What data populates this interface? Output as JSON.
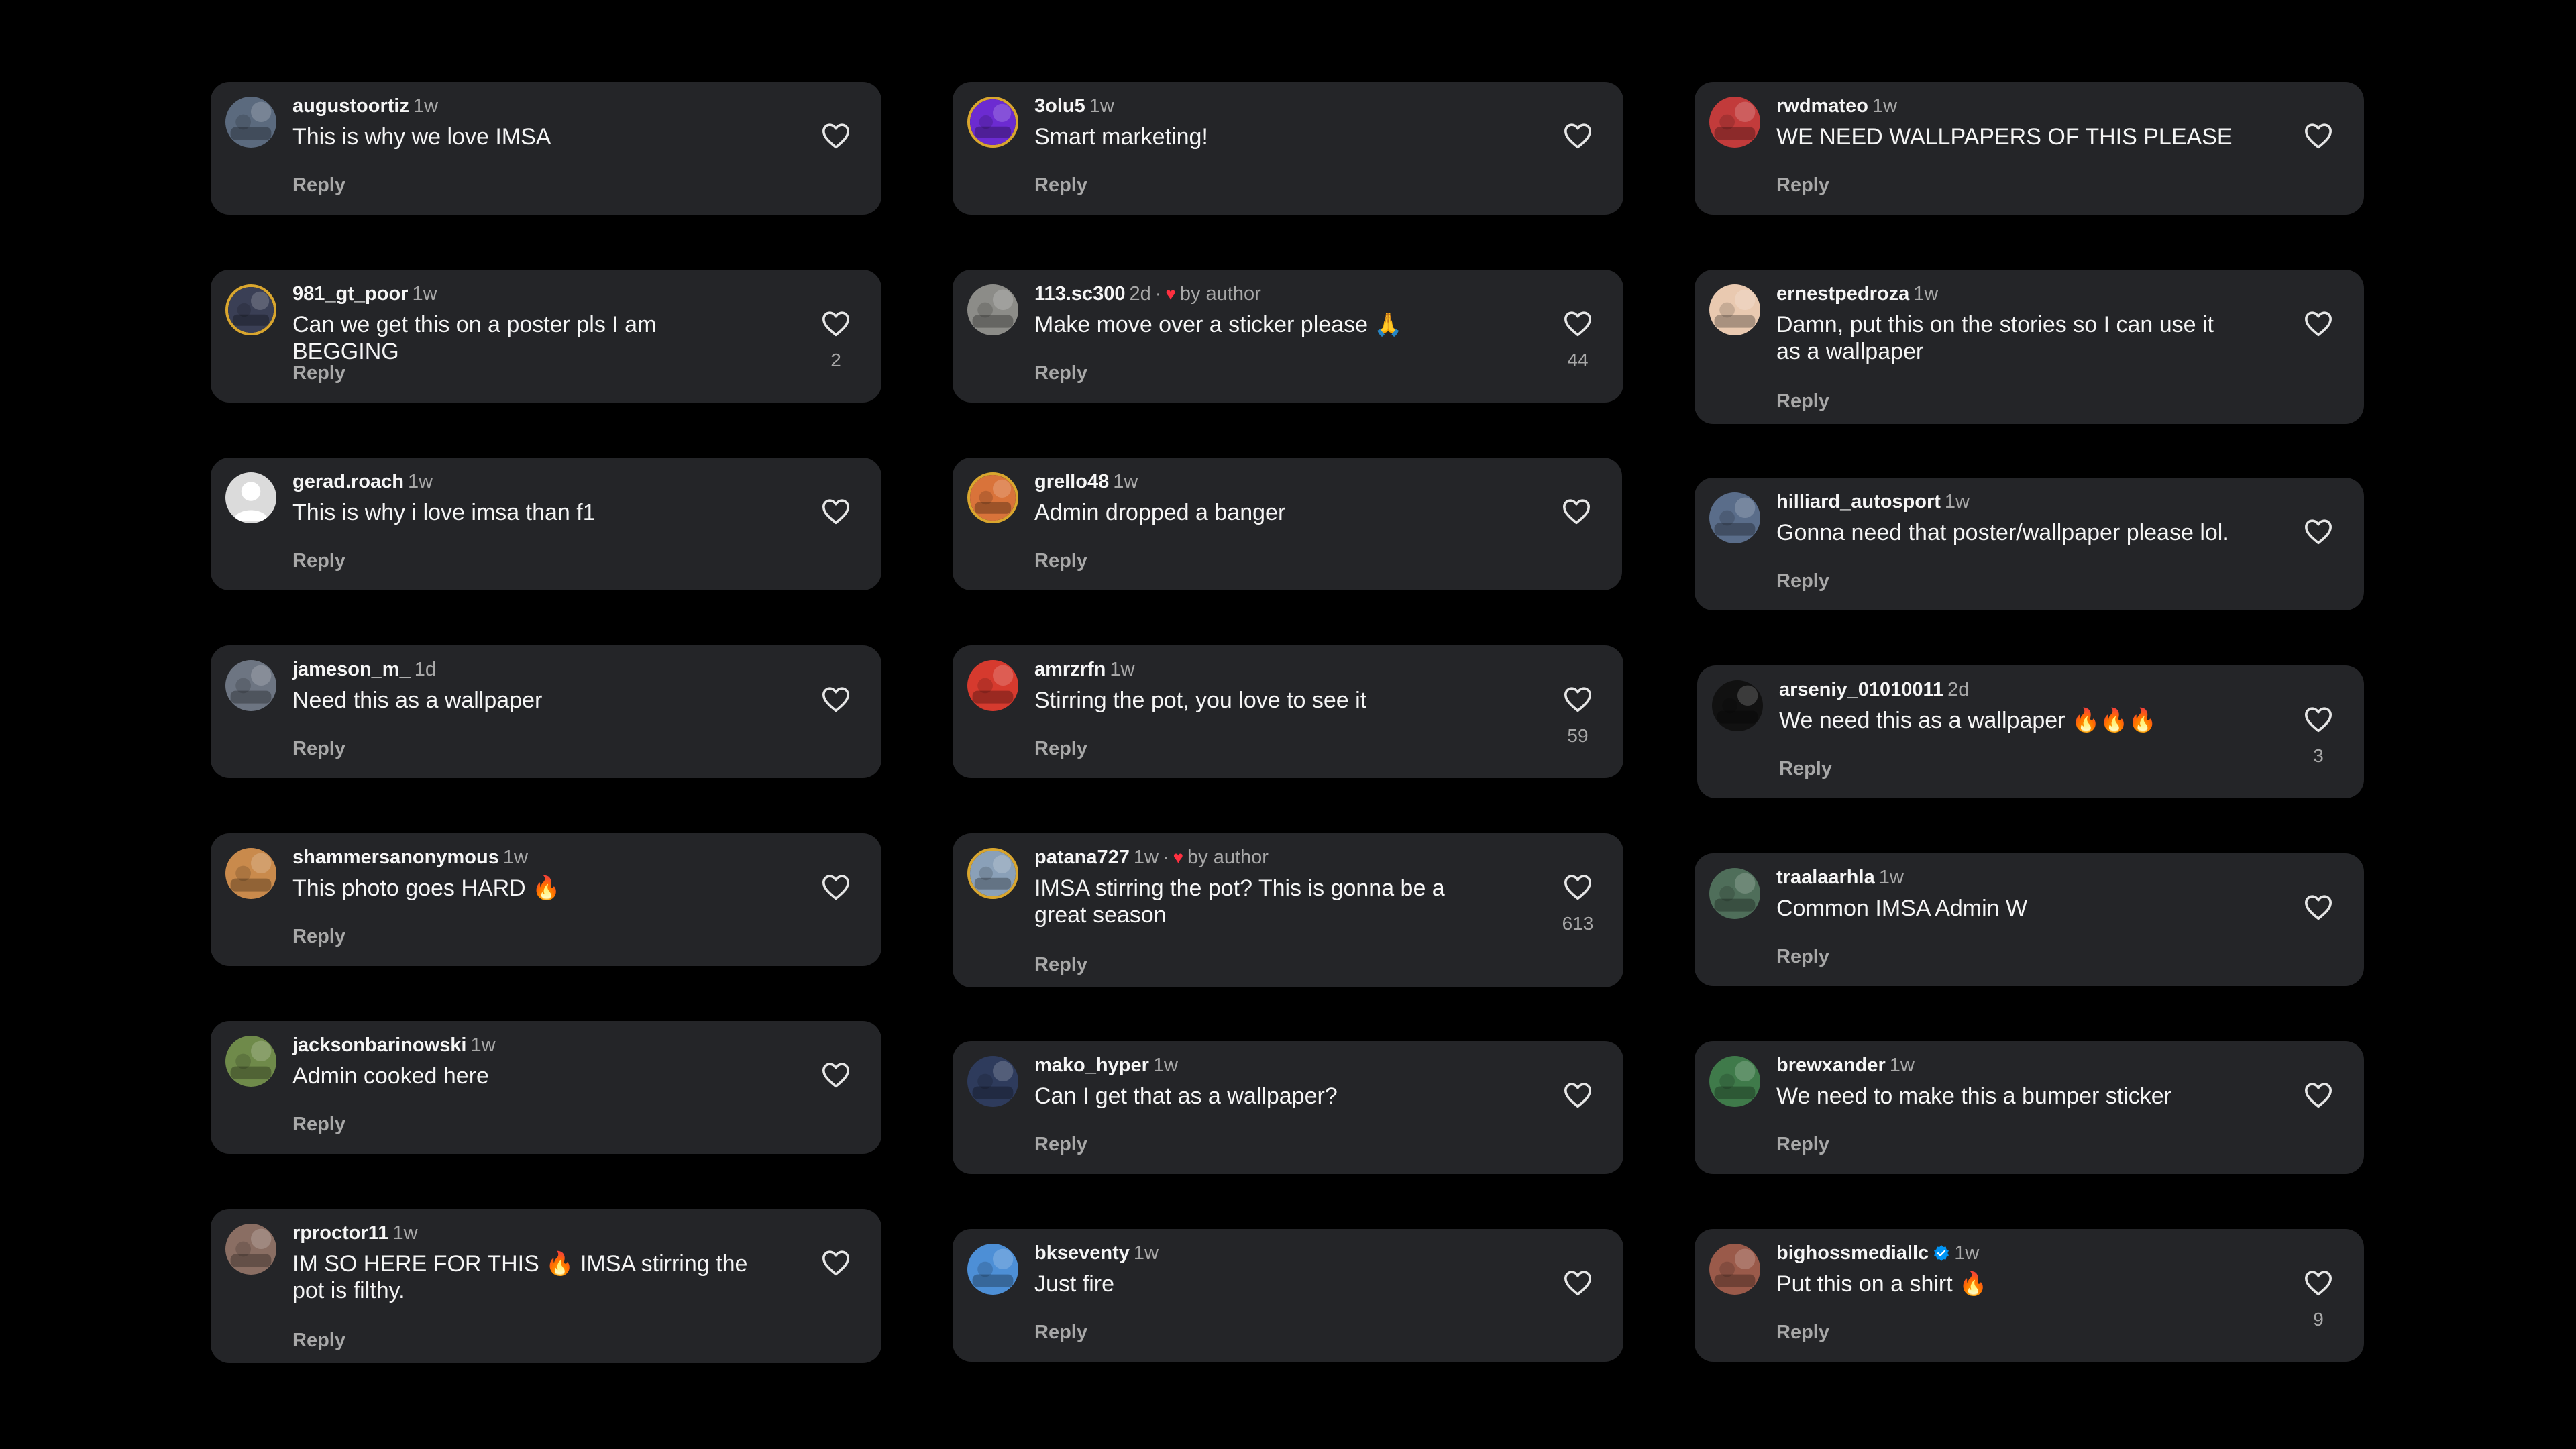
{
  "comments": [
    {
      "username": "augustoortiz",
      "time": "1w",
      "text": "This is why we love IMSA",
      "reply": "Reply",
      "likes": "",
      "avatar_icon": "car-photo-avatar",
      "avatar_color": "#5b6a7e"
    },
    {
      "username": "981_gt_poor",
      "time": "1w",
      "text": "Can we get this on a poster pls I am BEGGING",
      "reply": "Reply",
      "likes": "2",
      "avatar_icon": "car-photo-avatar",
      "avatar_color": "#3a3f55"
    },
    {
      "username": "gerad.roach",
      "time": "1w",
      "text": "This is why i love imsa than f1",
      "reply": "Reply",
      "likes": "",
      "avatar_icon": "default-user-avatar",
      "avatar_color": "#dbdbdb"
    },
    {
      "username": "jameson_m_",
      "time": "1d",
      "text": "Need this as a wallpaper",
      "reply": "Reply",
      "likes": "",
      "avatar_icon": "car-photo-avatar",
      "avatar_color": "#6d7582"
    },
    {
      "username": "shammersanonymous",
      "time": "1w",
      "text": "This photo goes HARD 🔥",
      "reply": "Reply",
      "likes": "",
      "avatar_icon": "dog-photo-avatar",
      "avatar_color": "#c98a4c"
    },
    {
      "username": "jacksonbarinowski",
      "time": "1w",
      "text": "Admin cooked here",
      "reply": "Reply",
      "likes": "",
      "avatar_icon": "person-photo-avatar",
      "avatar_color": "#6f8a4a"
    },
    {
      "username": "rproctor11",
      "time": "1w",
      "text": "IM SO HERE FOR THIS 🔥 IMSA stirring the pot is filthy.",
      "reply": "Reply",
      "likes": "",
      "avatar_icon": "person-photo-avatar",
      "avatar_color": "#8a6e63"
    },
    {
      "username": "3olu5",
      "time": "1w",
      "text": "Smart marketing!",
      "reply": "Reply",
      "likes": "",
      "avatar_icon": "purple-photo-avatar",
      "avatar_color": "#6c2bd1"
    },
    {
      "username": "113.sc300",
      "time": "2d",
      "by_author": "by author",
      "text": "Make move over a sticker please 🙏",
      "reply": "Reply",
      "likes": "44",
      "avatar_icon": "car-photo-avatar",
      "avatar_color": "#8c8c88"
    },
    {
      "username": "grello48",
      "time": "1w",
      "text": "Admin dropped a banger",
      "reply": "Reply",
      "likes": "",
      "avatar_icon": "orange-photo-avatar",
      "avatar_color": "#d9733a"
    },
    {
      "username": "amrzrfn",
      "time": "1w",
      "text": "Stirring the pot, you love to see it",
      "reply": "Reply",
      "likes": "59",
      "avatar_icon": "mario-photo-avatar",
      "avatar_color": "#d63a2e"
    },
    {
      "username": "patana727",
      "time": "1w",
      "by_author": "by author",
      "text": "IMSA stirring the pot? This is gonna be a great season",
      "reply": "Reply",
      "likes": "613",
      "avatar_icon": "beach-photo-avatar",
      "avatar_color": "#8aa0b8"
    },
    {
      "username": "mako_hyper",
      "time": "1w",
      "text": "Can I get that as a wallpaper?",
      "reply": "Reply",
      "likes": "",
      "avatar_icon": "car-photo-avatar",
      "avatar_color": "#2e3b5c"
    },
    {
      "username": "bkseventy",
      "time": "1w",
      "text": "Just fire",
      "reply": "Reply",
      "likes": "",
      "avatar_icon": "person-photo-avatar",
      "avatar_color": "#4d8fd6"
    },
    {
      "username": "rwdmateo",
      "time": "1w",
      "text": "WE NEED WALLPAPERS OF THIS PLEASE",
      "reply": "Reply",
      "likes": "",
      "avatar_icon": "car-photo-avatar",
      "avatar_color": "#c23b3b"
    },
    {
      "username": "ernestpedroza",
      "time": "1w",
      "text": "Damn, put this on the stories so I can use it as a wallpaper",
      "reply": "Reply",
      "likes": "",
      "avatar_icon": "person-photo-avatar",
      "avatar_color": "#e9c9b0"
    },
    {
      "username": "hilliard_autosport",
      "time": "1w",
      "text": "Gonna need that poster/wallpaper please lol.",
      "reply": "Reply",
      "likes": "",
      "avatar_icon": "person-photo-avatar",
      "avatar_color": "#5a6d8a"
    },
    {
      "username": "arseniy_01010011",
      "time": "2d",
      "text": "We need this as a wallpaper 🔥🔥🔥",
      "reply": "Reply",
      "likes": "3",
      "avatar_icon": "dark-photo-avatar",
      "avatar_color": "#111111"
    },
    {
      "username": "traalaarhla",
      "time": "1w",
      "text": "Common IMSA Admin W",
      "reply": "Reply",
      "likes": "",
      "avatar_icon": "car-photo-avatar",
      "avatar_color": "#4f6e5a"
    },
    {
      "username": "brewxander",
      "time": "1w",
      "text": "We need to make this a bumper sticker",
      "reply": "Reply",
      "likes": "",
      "avatar_icon": "car-photo-avatar",
      "avatar_color": "#3f7a4a"
    },
    {
      "username": "bighossmediallc",
      "time": "1w",
      "text": "Put this on a shirt 🔥",
      "reply": "Reply",
      "likes": "9",
      "verified": true,
      "avatar_icon": "person-photo-avatar",
      "avatar_color": "#9a5a4a"
    }
  ],
  "colors": {
    "background": "#000000",
    "card": "#242528",
    "text_primary": "#f5f5f5",
    "text_secondary": "#a8a8a8",
    "author_heart": "#ff3040",
    "verified": "#0095f6"
  },
  "icons": {
    "like": "heart-outline-icon",
    "author_like": "heart-filled-icon",
    "verified": "verified-badge-icon"
  }
}
